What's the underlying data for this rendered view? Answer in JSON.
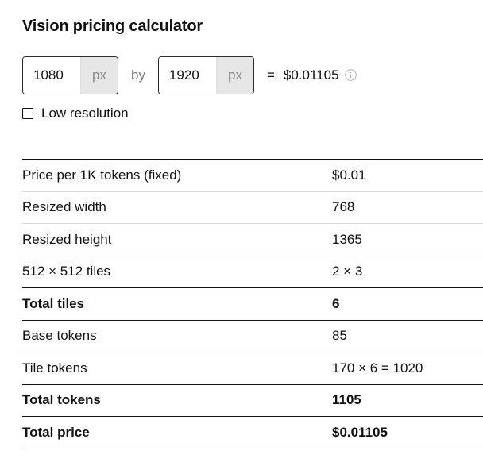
{
  "title": "Vision pricing calculator",
  "inputs": {
    "width": {
      "value": "1080",
      "unit": "px"
    },
    "separator": "by",
    "height": {
      "value": "1920",
      "unit": "px"
    },
    "equals": "=",
    "price": "$0.01105",
    "info_icon": "info-icon"
  },
  "low_resolution": {
    "label": "Low resolution",
    "checked": false
  },
  "breakdown": [
    {
      "label": "Price per 1K tokens (fixed)",
      "value": "$0.01",
      "bold": false
    },
    {
      "label": "Resized width",
      "value": "768",
      "bold": false
    },
    {
      "label": "Resized height",
      "value": "1365",
      "bold": false
    },
    {
      "label": "512 × 512 tiles",
      "value": "2 × 3",
      "bold": false
    },
    {
      "label": "Total tiles",
      "value": "6",
      "bold": true
    },
    {
      "label": "Base tokens",
      "value": "85",
      "bold": false
    },
    {
      "label": "Tile tokens",
      "value": "170 × 6 = 1020",
      "bold": false
    },
    {
      "label": "Total tokens",
      "value": "1105",
      "bold": true
    },
    {
      "label": "Total price",
      "value": "$0.01105",
      "bold": true
    }
  ]
}
